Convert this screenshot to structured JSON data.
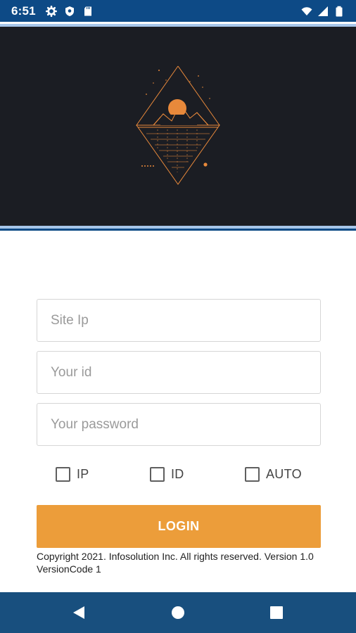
{
  "status_bar": {
    "time": "6:51",
    "left_icons": [
      "gear-icon",
      "shield-icon",
      "sd-card-icon"
    ],
    "right_icons": [
      "wifi-icon",
      "signal-icon",
      "battery-icon"
    ]
  },
  "hero": {
    "background_color": "#1b1d23",
    "logo_icon": "mountain-sun-diamond-logo",
    "logo_color": "#e8893b"
  },
  "form": {
    "site_ip_placeholder": "Site Ip",
    "id_placeholder": "Your id",
    "password_placeholder": "Your password"
  },
  "options": [
    {
      "label": "IP",
      "checked": false
    },
    {
      "label": "ID",
      "checked": false
    },
    {
      "label": "AUTO",
      "checked": false
    }
  ],
  "login_button": {
    "label": "LOGIN",
    "color": "#ec9d3a"
  },
  "footer": {
    "copyright": "Copyright 2021. Infosolution Inc. All rights reserved. Version 1.0 VersionCode 1"
  },
  "nav_bar": {
    "buttons": [
      "back-icon",
      "home-icon",
      "recents-icon"
    ],
    "color": "#184f7e"
  },
  "theme": {
    "status_bar_color": "#0d4a86",
    "stripe_color": "#a7c6ea"
  }
}
